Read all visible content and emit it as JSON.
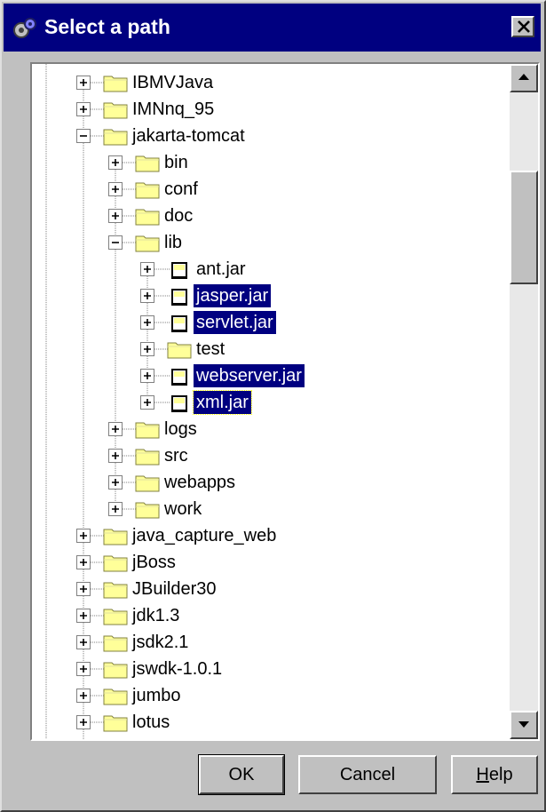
{
  "window": {
    "title": "Select a path",
    "title_icon": "gears-icon",
    "close_icon": "close-icon"
  },
  "tree": {
    "nodes": [
      {
        "label": "IBMVJava",
        "depth": 0,
        "icon": "folder-icon",
        "expanded": false,
        "selected": false
      },
      {
        "label": "IMNnq_95",
        "depth": 0,
        "icon": "folder-icon",
        "expanded": false,
        "selected": false
      },
      {
        "label": "jakarta-tomcat",
        "depth": 0,
        "icon": "folder-icon",
        "expanded": true,
        "selected": false
      },
      {
        "label": "bin",
        "depth": 1,
        "icon": "folder-icon",
        "expanded": false,
        "selected": false
      },
      {
        "label": "conf",
        "depth": 1,
        "icon": "folder-icon",
        "expanded": false,
        "selected": false
      },
      {
        "label": "doc",
        "depth": 1,
        "icon": "folder-icon",
        "expanded": false,
        "selected": false
      },
      {
        "label": "lib",
        "depth": 1,
        "icon": "folder-icon",
        "expanded": true,
        "selected": false
      },
      {
        "label": "ant.jar",
        "depth": 2,
        "icon": "jar-file-icon",
        "expanded": false,
        "selected": false
      },
      {
        "label": "jasper.jar",
        "depth": 2,
        "icon": "jar-file-icon",
        "expanded": false,
        "selected": true
      },
      {
        "label": "servlet.jar",
        "depth": 2,
        "icon": "jar-file-icon",
        "expanded": false,
        "selected": true
      },
      {
        "label": "test",
        "depth": 2,
        "icon": "folder-icon",
        "expanded": false,
        "selected": false
      },
      {
        "label": "webserver.jar",
        "depth": 2,
        "icon": "jar-file-icon",
        "expanded": false,
        "selected": true
      },
      {
        "label": "xml.jar",
        "depth": 2,
        "icon": "jar-file-icon",
        "expanded": false,
        "selected": true,
        "focused": true
      },
      {
        "label": "logs",
        "depth": 1,
        "icon": "folder-icon",
        "expanded": false,
        "selected": false
      },
      {
        "label": "src",
        "depth": 1,
        "icon": "folder-icon",
        "expanded": false,
        "selected": false
      },
      {
        "label": "webapps",
        "depth": 1,
        "icon": "folder-icon",
        "expanded": false,
        "selected": false
      },
      {
        "label": "work",
        "depth": 1,
        "icon": "folder-icon",
        "expanded": false,
        "selected": false
      },
      {
        "label": "java_capture_web",
        "depth": 0,
        "icon": "folder-icon",
        "expanded": false,
        "selected": false
      },
      {
        "label": "jBoss",
        "depth": 0,
        "icon": "folder-icon",
        "expanded": false,
        "selected": false
      },
      {
        "label": "JBuilder30",
        "depth": 0,
        "icon": "folder-icon",
        "expanded": false,
        "selected": false
      },
      {
        "label": "jdk1.3",
        "depth": 0,
        "icon": "folder-icon",
        "expanded": false,
        "selected": false
      },
      {
        "label": "jsdk2.1",
        "depth": 0,
        "icon": "folder-icon",
        "expanded": false,
        "selected": false
      },
      {
        "label": "jswdk-1.0.1",
        "depth": 0,
        "icon": "folder-icon",
        "expanded": false,
        "selected": false
      },
      {
        "label": "jumbo",
        "depth": 0,
        "icon": "folder-icon",
        "expanded": false,
        "selected": false
      },
      {
        "label": "lotus",
        "depth": 0,
        "icon": "folder-icon",
        "expanded": false,
        "selected": false
      }
    ]
  },
  "scrollbar": {
    "up_icon": "scroll-up-arrow-icon",
    "down_icon": "scroll-down-arrow-icon"
  },
  "buttons": {
    "ok": "OK",
    "cancel": "Cancel",
    "help_mnemonic": "H",
    "help_rest": "elp"
  },
  "colors": {
    "selection": "#000080",
    "folder": "#ffff99",
    "titlebar": "#000080"
  }
}
